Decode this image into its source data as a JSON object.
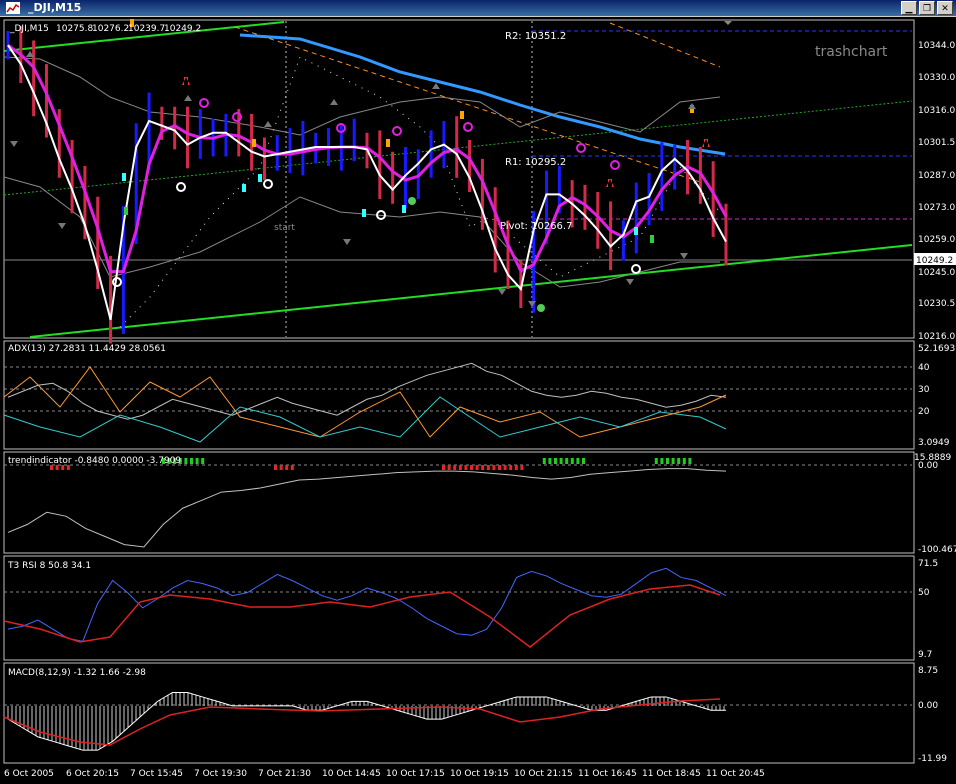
{
  "window": {
    "title": "_DJI,M15"
  },
  "main": {
    "header": [
      "_DJI,M15",
      "10275.8",
      "10276.2",
      "10239.7",
      "10249.2"
    ],
    "watermark": "trashchart",
    "current_price": "10249.2",
    "price_labels": [
      "10344.0",
      "10330.0",
      "10316.0",
      "10301.5",
      "10287.0",
      "10273.0",
      "10259.0",
      "10245.0",
      "10230.5",
      "10216.0"
    ],
    "levels": {
      "r2": "R2: 10351.2",
      "r1": "R1: 10295.2",
      "pivot": "Pivot: 10266.7"
    },
    "start_label": "start"
  },
  "adx": {
    "header": "ADX(13) 27.2831 11.4429 28.0561",
    "labels": [
      "52.1693",
      "40",
      "30",
      "20",
      "3.0949"
    ]
  },
  "trend": {
    "header": "trendindicator -0.8480 0.0000 -3.7909",
    "labels": [
      "15.8889",
      "0.00",
      "-100.467"
    ]
  },
  "rsi": {
    "header": "T3 RSI 8 50.8 34.1",
    "labels": [
      "71.5",
      "50",
      "9.7"
    ]
  },
  "macd": {
    "header": "MACD(8,12,9) -1.32 1.66 -2.98",
    "labels": [
      "8.75",
      "0.00",
      "-11.99"
    ]
  },
  "time_labels": [
    "6 Oct 2005",
    "6 Oct 20:15",
    "7 Oct 15:45",
    "7 Oct 19:30",
    "7 Oct 21:30",
    "10 Oct 14:45",
    "10 Oct 17:15",
    "10 Oct 19:15",
    "10 Oct 21:15",
    "11 Oct 16:45",
    "11 Oct 18:45",
    "11 Oct 20:45"
  ],
  "chart_data": {
    "type": "line",
    "series": [
      {
        "name": "_DJI,M15",
        "values": [
          10338,
          10330,
          10318,
          10305,
          10290,
          10277,
          10262,
          10243,
          10222,
          10262,
          10295,
          10306,
          10304,
          10302,
          10296,
          10299,
          10301,
          10301,
          10297,
          10293,
          10291,
          10292,
          10293,
          10294,
          10295,
          10295,
          10295,
          10295,
          10294,
          10283,
          10277,
          10283,
          10288,
          10294,
          10296,
          10292,
          10282,
          10268,
          10252,
          10241,
          10235,
          10260,
          10275,
          10275,
          10271,
          10266,
          10260,
          10253,
          10258,
          10272,
          10274,
          10285,
          10290,
          10285,
          10277,
          10265,
          10255
        ]
      },
      {
        "name": "ADX(13)",
        "values": [
          27,
          30,
          33,
          34,
          30,
          24,
          20,
          18,
          16,
          18,
          22,
          26,
          24,
          22,
          20,
          18,
          21,
          24,
          27,
          24,
          22,
          20,
          18,
          22,
          26,
          28,
          32,
          35,
          38,
          40,
          42,
          44,
          40,
          38,
          34,
          30,
          28,
          27,
          28,
          30,
          29,
          27,
          26,
          24,
          22,
          23,
          25,
          28,
          27
        ]
      },
      {
        "name": "trendindicator",
        "values": [
          -80,
          -70,
          -55,
          -60,
          -75,
          -85,
          -95,
          -98,
          -70,
          -50,
          -40,
          -30,
          -28,
          -25,
          -20,
          -15,
          -14,
          -12,
          -10,
          -8,
          -6,
          -5,
          -4,
          -4,
          -5,
          -7,
          -9,
          -12,
          -14,
          -12,
          -8,
          -6,
          -4,
          -2,
          -1,
          -1,
          -3,
          -4
        ]
      },
      {
        "name": "T3 RSI 8",
        "values": [
          28,
          30,
          34,
          28,
          22,
          20,
          45,
          60,
          52,
          42,
          48,
          55,
          60,
          58,
          55,
          50,
          52,
          58,
          64,
          60,
          55,
          50,
          47,
          50,
          55,
          52,
          48,
          42,
          35,
          30,
          25,
          24,
          28,
          42,
          62,
          66,
          63,
          58,
          54,
          50,
          49,
          51,
          58,
          65,
          68,
          62,
          60,
          55,
          50
        ]
      },
      {
        "name": "MACD(8,12,9)",
        "values": [
          -3,
          -5,
          -7,
          -8,
          -9,
          -10,
          -10,
          -8,
          -5,
          -2,
          1,
          3,
          3,
          2,
          1,
          0,
          0,
          0,
          0,
          0,
          -1,
          -1,
          0,
          1,
          1,
          0,
          -1,
          -2,
          -3,
          -3,
          -2,
          -1,
          0,
          1,
          2,
          2,
          2,
          1,
          0,
          -1,
          -1,
          0,
          1,
          2,
          2,
          1,
          0,
          -1,
          -1
        ]
      }
    ]
  }
}
